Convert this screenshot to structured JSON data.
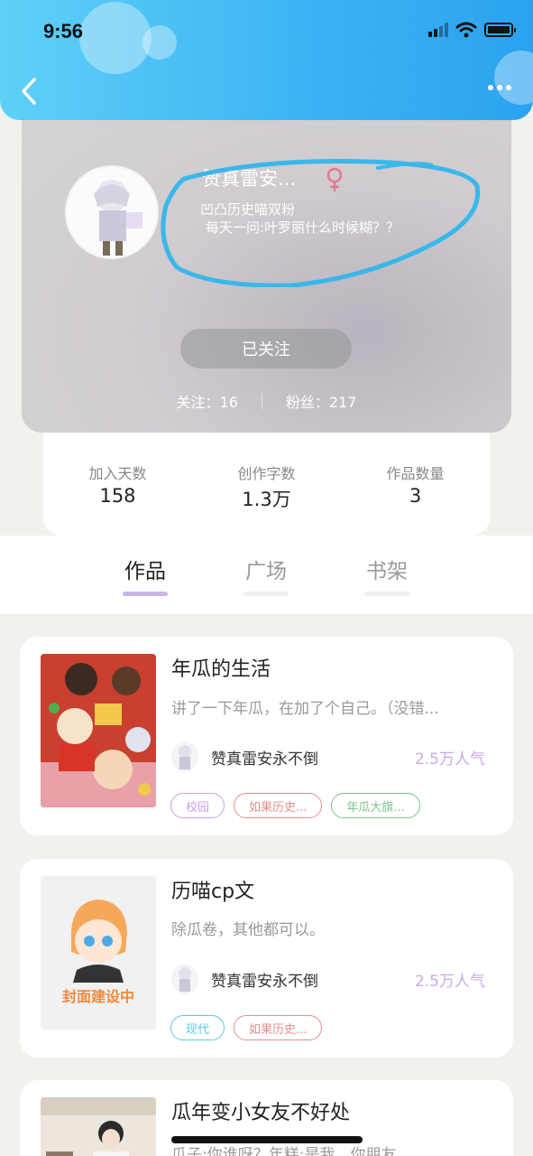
{
  "status_bar": {
    "time": "9:56"
  },
  "header": {
    "back_icon": "chevron-left-icon",
    "more_icon": "more-dots-icon"
  },
  "profile": {
    "nickname": "赞真雷安...",
    "gender_symbol": "♀",
    "gender_color": "#e2788f",
    "bio_line1": "凹凸历史喵双粉",
    "bio_line2": "每天一问:叶罗丽什么时候糊？？",
    "follow_button": "已关注",
    "following_label": "关注：16",
    "followers_label": "粉丝：217"
  },
  "stats": [
    {
      "label": "加入天数",
      "value": "158"
    },
    {
      "label": "创作字数",
      "value": "1.3万"
    },
    {
      "label": "作品数量",
      "value": "3"
    }
  ],
  "tabs": [
    {
      "label": "作品",
      "active": true
    },
    {
      "label": "广场",
      "active": false
    },
    {
      "label": "书架",
      "active": false
    }
  ],
  "works": [
    {
      "title": "年瓜的生活",
      "description": "讲了一下年瓜，在加了个自己。（没错...",
      "author": "赞真雷安永不倒",
      "popularity": "2.5万人气",
      "tags": [
        {
          "label": "校园",
          "color": "#c7a3e8"
        },
        {
          "label": "如果历史...",
          "color": "#e88c8c"
        },
        {
          "label": "年瓜大旗...",
          "color": "#7cc48a"
        }
      ]
    },
    {
      "title": "历喵cp文",
      "description": "除瓜卷，其他都可以。",
      "author": "赞真雷安永不倒",
      "popularity": "2.5万人气",
      "cover_text": "封面建设中",
      "tags": [
        {
          "label": "现代",
          "color": "#5dc6e6"
        },
        {
          "label": "如果历史...",
          "color": "#e88c8c"
        }
      ]
    },
    {
      "title": "瓜年变小女友不好处",
      "description": "瓜子:你谁呀？年糕:是我，你朋友"
    }
  ],
  "colors": {
    "accent": "#3bb2f4",
    "tab_indicator": "#c6b7e6",
    "popularity": "#c9a9e8"
  }
}
